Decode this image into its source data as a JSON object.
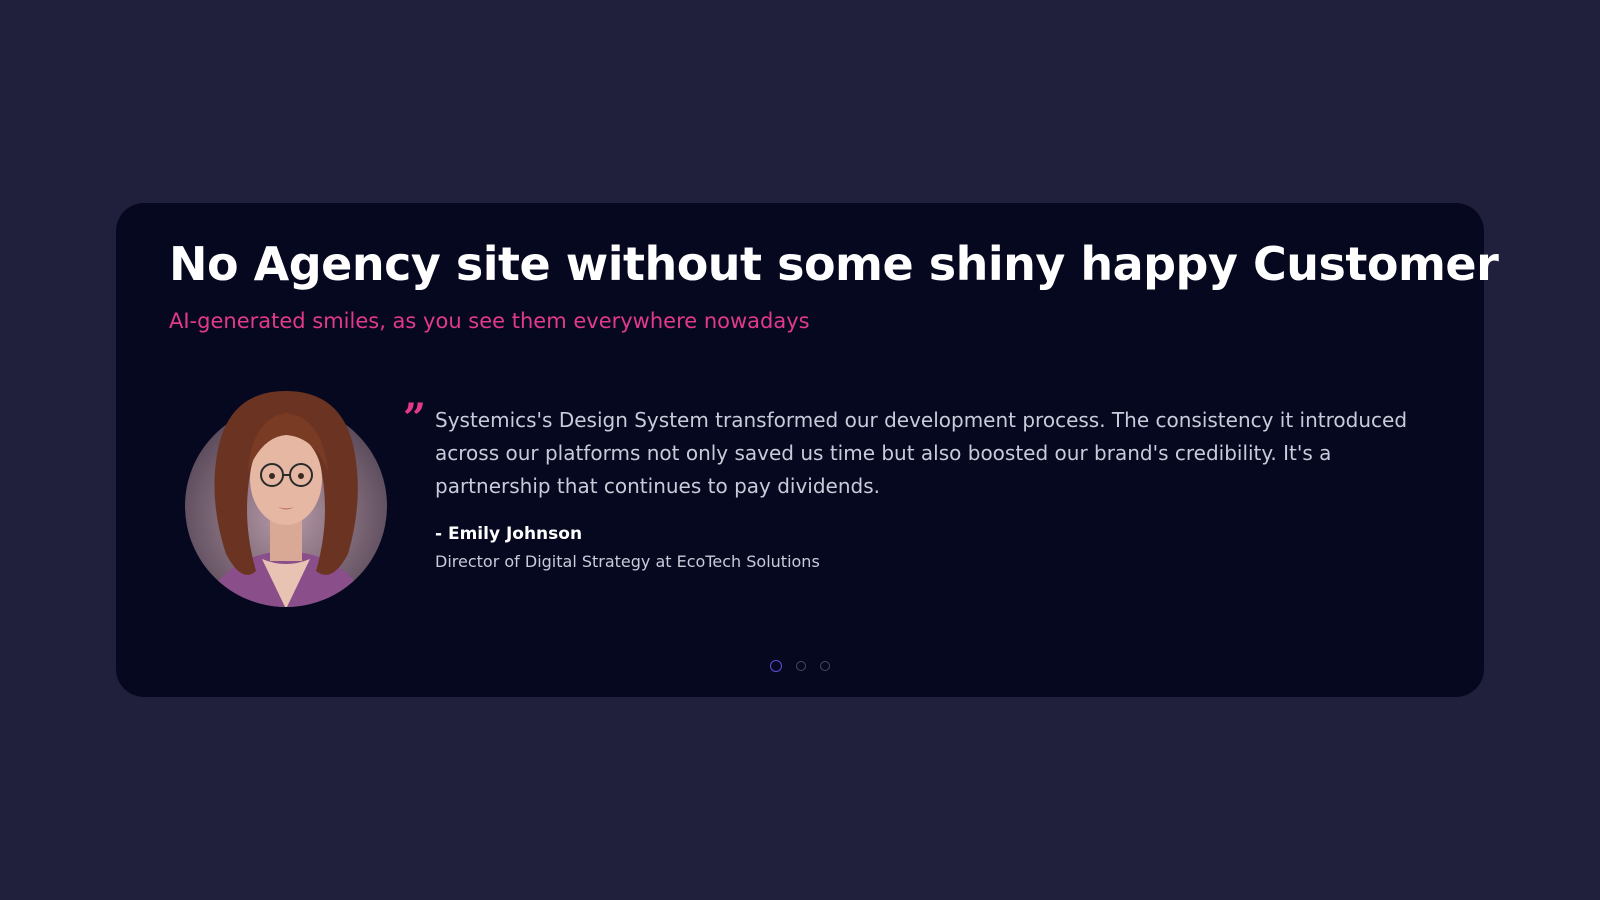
{
  "section": {
    "title": "No Agency site without some shiny happy Customer",
    "subtitle": "AI-generated smiles, as you see them everywhere nowadays"
  },
  "testimonial": {
    "quote_icon": "quote-icon",
    "quote": "Systemics's Design System transformed our development process. The consistency it introduced across our platforms not only saved us time but also boosted our brand's credibility. It's a partnership that continues to pay dividends.",
    "author_name": "- Emily Johnson",
    "author_role": "Director of Digital Strategy at EcoTech Solutions",
    "avatar_icon": "avatar"
  },
  "carousel": {
    "slide_count": 3,
    "active_index": 0
  },
  "colors": {
    "page_background": "#20203c",
    "card_background": "#060820",
    "accent": "#e2398c",
    "active_dot": "#5b4fd6"
  }
}
